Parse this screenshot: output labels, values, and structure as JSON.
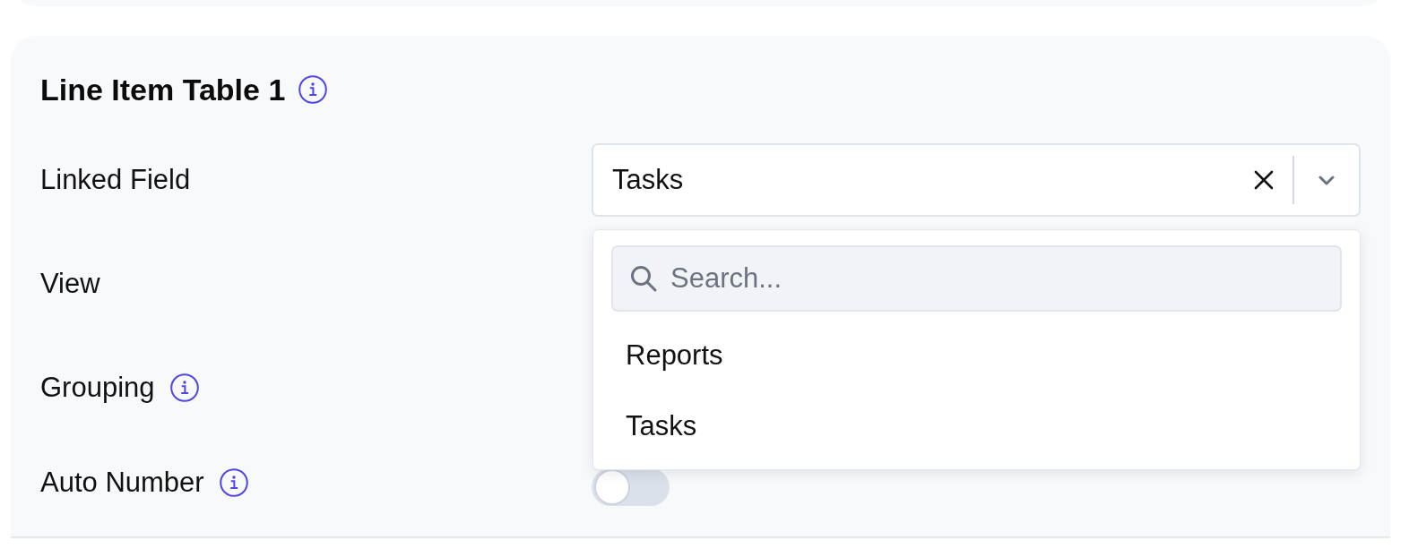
{
  "section": {
    "title": "Line Item Table 1",
    "info": true
  },
  "fields": [
    {
      "kind": "select",
      "label": "Linked Field",
      "info": false,
      "value": "Tasks",
      "menu": {
        "open": true,
        "search": {
          "placeholder": "Search..."
        },
        "options": [
          {
            "label": "Reports"
          },
          {
            "label": "Tasks"
          }
        ]
      }
    },
    {
      "label": "View",
      "info": false
    },
    {
      "label": "Grouping",
      "info": true
    },
    {
      "kind": "toggle",
      "label": "Auto Number",
      "info": true,
      "on": false
    }
  ]
}
